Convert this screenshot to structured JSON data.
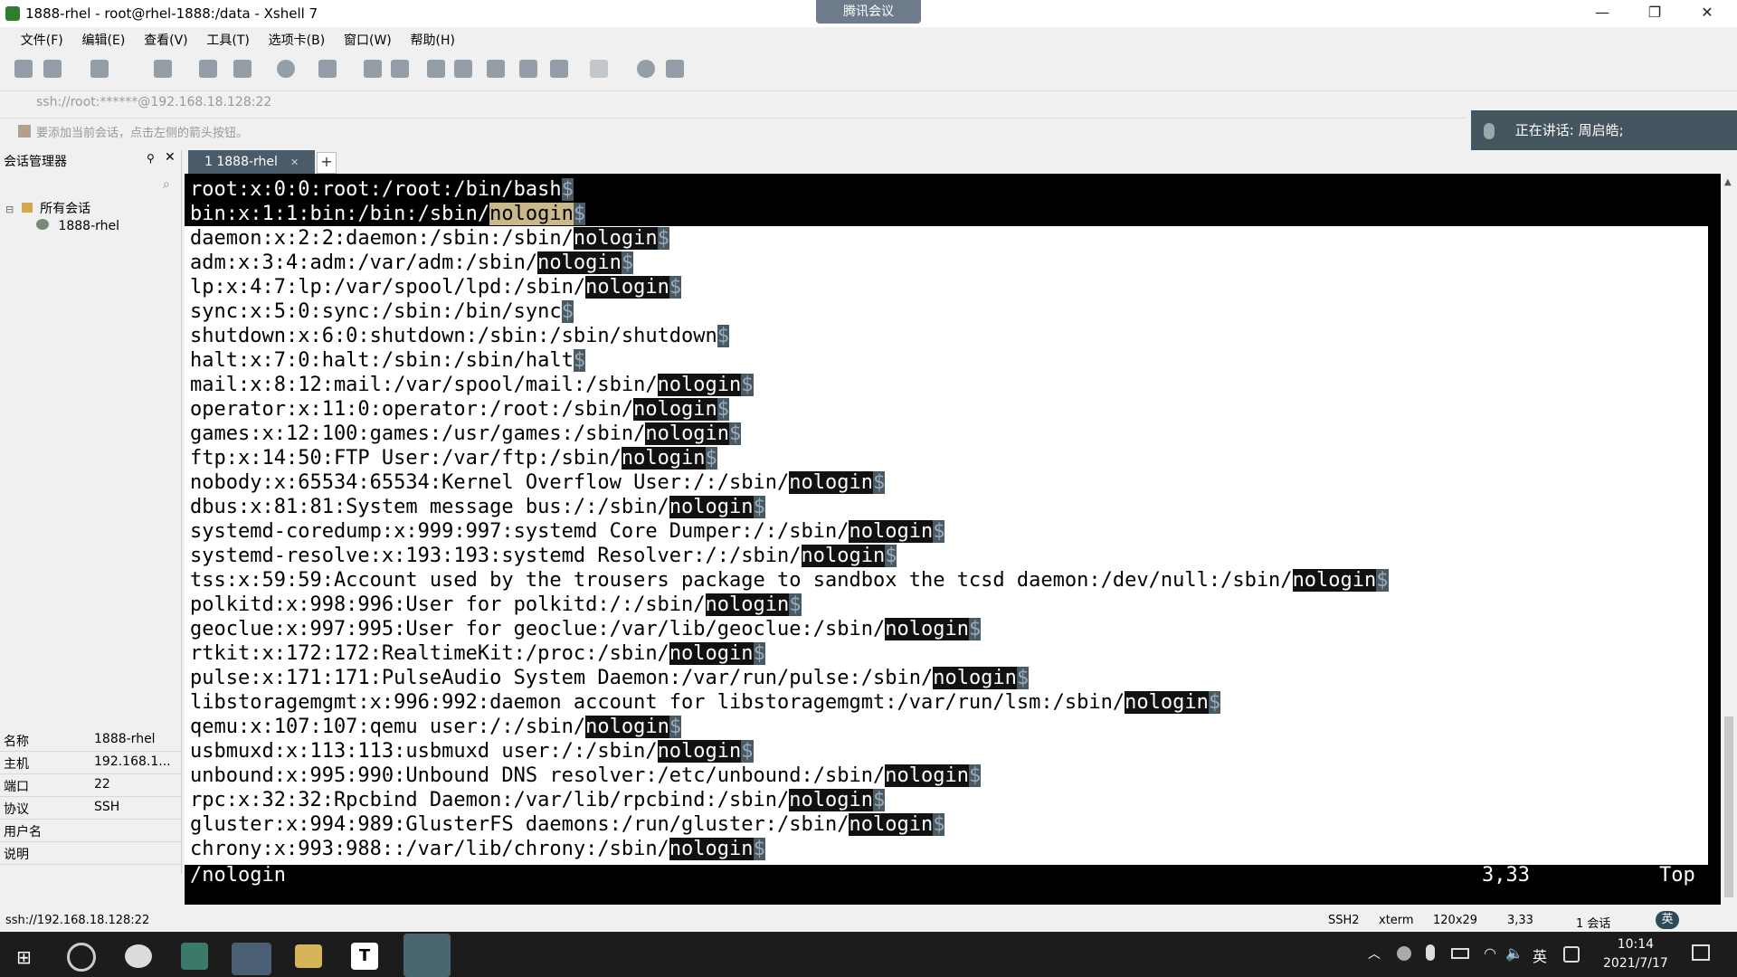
{
  "window": {
    "title": "1888-rhel - root@rhel-1888:/data - Xshell 7",
    "meeting_badge": "腾讯会议",
    "minimize": "—",
    "restore": "❐",
    "close": "✕"
  },
  "menu": [
    "文件(F)",
    "编辑(E)",
    "查看(V)",
    "工具(T)",
    "选项卡(B)",
    "窗口(W)",
    "帮助(H)"
  ],
  "address": "ssh://root:******@192.168.18.128:22",
  "hint": "要添加当前会话，点击左侧的箭头按钮。",
  "speaking": "正在讲话: 周启皓;",
  "session_manager": {
    "header": "会话管理器",
    "tree_root": "所有会话",
    "tree_child": "1888-rhel",
    "properties": [
      {
        "key": "名称",
        "value": "1888-rhel"
      },
      {
        "key": "主机",
        "value": "192.168.1..."
      },
      {
        "key": "端口",
        "value": "22"
      },
      {
        "key": "协议",
        "value": "SSH"
      },
      {
        "key": "用户名",
        "value": ""
      },
      {
        "key": "说明",
        "value": ""
      }
    ]
  },
  "tab": {
    "label": "1 1888-rhel",
    "add": "+"
  },
  "terminal": {
    "lines": [
      {
        "pre": "root:x:0:0:root:/root:/bin/bash",
        "hl": "",
        "dark": true
      },
      {
        "pre": "bin:x:1:1:bin:/bin:/sbin/",
        "hl": "nologin",
        "dark": true
      },
      {
        "pre": "daemon:x:2:2:daemon:/sbin:/sbin/",
        "hl": "nologin",
        "dark": false
      },
      {
        "pre": "adm:x:3:4:adm:/var/adm:/sbin/",
        "hl": "nologin",
        "dark": false
      },
      {
        "pre": "lp:x:4:7:lp:/var/spool/lpd:/sbin/",
        "hl": "nologin",
        "dark": false
      },
      {
        "pre": "sync:x:5:0:sync:/sbin:/bin/sync",
        "hl": "",
        "dark": false
      },
      {
        "pre": "shutdown:x:6:0:shutdown:/sbin:/sbin/shutdown",
        "hl": "",
        "dark": false
      },
      {
        "pre": "halt:x:7:0:halt:/sbin:/sbin/halt",
        "hl": "",
        "dark": false
      },
      {
        "pre": "mail:x:8:12:mail:/var/spool/mail:/sbin/",
        "hl": "nologin",
        "dark": false
      },
      {
        "pre": "operator:x:11:0:operator:/root:/sbin/",
        "hl": "nologin",
        "dark": false
      },
      {
        "pre": "games:x:12:100:games:/usr/games:/sbin/",
        "hl": "nologin",
        "dark": false
      },
      {
        "pre": "ftp:x:14:50:FTP User:/var/ftp:/sbin/",
        "hl": "nologin",
        "dark": false
      },
      {
        "pre": "nobody:x:65534:65534:Kernel Overflow User:/:/sbin/",
        "hl": "nologin",
        "dark": false
      },
      {
        "pre": "dbus:x:81:81:System message bus:/:/sbin/",
        "hl": "nologin",
        "dark": false
      },
      {
        "pre": "systemd-coredump:x:999:997:systemd Core Dumper:/:/sbin/",
        "hl": "nologin",
        "dark": false
      },
      {
        "pre": "systemd-resolve:x:193:193:systemd Resolver:/:/sbin/",
        "hl": "nologin",
        "dark": false
      },
      {
        "pre": "tss:x:59:59:Account used by the trousers package to sandbox the tcsd daemon:/dev/null:/sbin/",
        "hl": "nologin",
        "dark": false
      },
      {
        "pre": "polkitd:x:998:996:User for polkitd:/:/sbin/",
        "hl": "nologin",
        "dark": false
      },
      {
        "pre": "geoclue:x:997:995:User for geoclue:/var/lib/geoclue:/sbin/",
        "hl": "nologin",
        "dark": false
      },
      {
        "pre": "rtkit:x:172:172:RealtimeKit:/proc:/sbin/",
        "hl": "nologin",
        "dark": false
      },
      {
        "pre": "pulse:x:171:171:PulseAudio System Daemon:/var/run/pulse:/sbin/",
        "hl": "nologin",
        "dark": false
      },
      {
        "pre": "libstoragemgmt:x:996:992:daemon account for libstoragemgmt:/var/run/lsm:/sbin/",
        "hl": "nologin",
        "dark": false
      },
      {
        "pre": "qemu:x:107:107:qemu user:/:/sbin/",
        "hl": "nologin",
        "dark": false
      },
      {
        "pre": "usbmuxd:x:113:113:usbmuxd user:/:/sbin/",
        "hl": "nologin",
        "dark": false
      },
      {
        "pre": "unbound:x:995:990:Unbound DNS resolver:/etc/unbound:/sbin/",
        "hl": "nologin",
        "dark": false
      },
      {
        "pre": "rpc:x:32:32:Rpcbind Daemon:/var/lib/rpcbind:/sbin/",
        "hl": "nologin",
        "dark": false
      },
      {
        "pre": "gluster:x:994:989:GlusterFS daemons:/run/gluster:/sbin/",
        "hl": "nologin",
        "dark": false
      },
      {
        "pre": "chrony:x:993:988::/var/lib/chrony:/sbin/",
        "hl": "nologin",
        "dark": false
      }
    ],
    "eol": "$",
    "command": "/nologin",
    "position": "3,33",
    "scroll": "Top"
  },
  "status": {
    "left": "ssh://192.168.18.128:22",
    "protocol": "SSH2",
    "term": "xterm",
    "size": "120x29",
    "cursor": "3,33",
    "sessions": "1 会话",
    "ime": "英"
  },
  "taskbar": {
    "time": "10:14",
    "date": "2021/7/17",
    "ime": "英"
  }
}
